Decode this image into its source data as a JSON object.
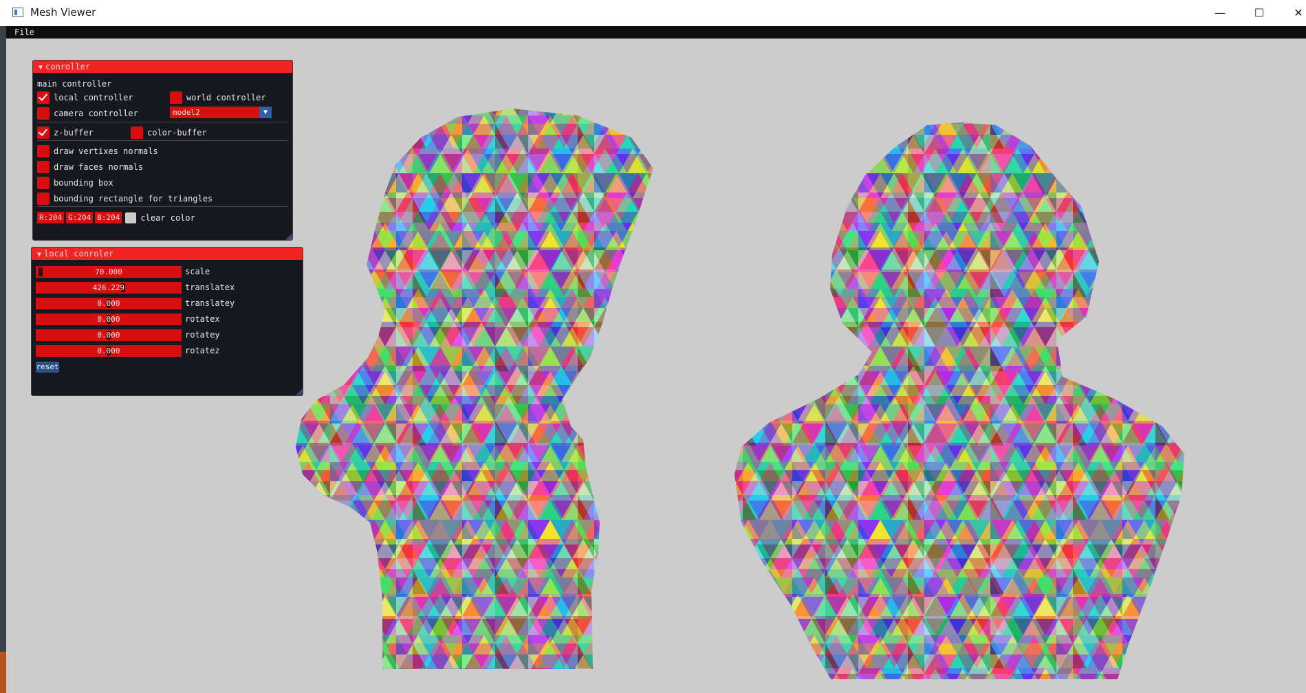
{
  "window": {
    "title": "Mesh Viewer",
    "minimize_glyph": "—",
    "maximize_glyph": "☐",
    "close_glyph": "✕"
  },
  "menubar": {
    "items": [
      "File"
    ]
  },
  "controller_panel": {
    "title": "conroller",
    "section_label": "main controller",
    "local_controller": {
      "label": "local controller",
      "checked": true
    },
    "world_controller": {
      "label": "world controller",
      "checked": false
    },
    "camera_controller": {
      "label": "camera controller",
      "checked": false
    },
    "model_select": {
      "value": "model2",
      "arrow": "▼"
    },
    "z_buffer": {
      "label": "z-buffer",
      "checked": true
    },
    "color_buffer": {
      "label": "color-buffer",
      "checked": false
    },
    "options": [
      {
        "label": "draw vertixes normals",
        "checked": false
      },
      {
        "label": "draw faces normals",
        "checked": false
      },
      {
        "label": "bounding box",
        "checked": false
      },
      {
        "label": "bounding rectangle for triangles",
        "checked": false
      }
    ],
    "clear_color": {
      "r": "R:204",
      "g": "G:204",
      "b": "B:204",
      "label": "clear color",
      "swatch": "#cccccc"
    }
  },
  "local_panel": {
    "title": "local conroler",
    "sliders": [
      {
        "label": "scale",
        "value": "70.000",
        "position": 0.02
      },
      {
        "label": "translatex",
        "value": "426.229",
        "position": 0.6
      },
      {
        "label": "translatey",
        "value": "0.000",
        "position": 0.5
      },
      {
        "label": "rotatex",
        "value": "0.000",
        "position": 0.5
      },
      {
        "label": "rotatey",
        "value": "0.000",
        "position": 0.5
      },
      {
        "label": "rotatez",
        "value": "0.000",
        "position": 0.5
      }
    ],
    "reset_label": "reset"
  },
  "colors": {
    "accent": "#d70f0f",
    "title_bar": "#f12424",
    "panel_bg": "#16171f",
    "viewport_bg": "#cccccc"
  }
}
